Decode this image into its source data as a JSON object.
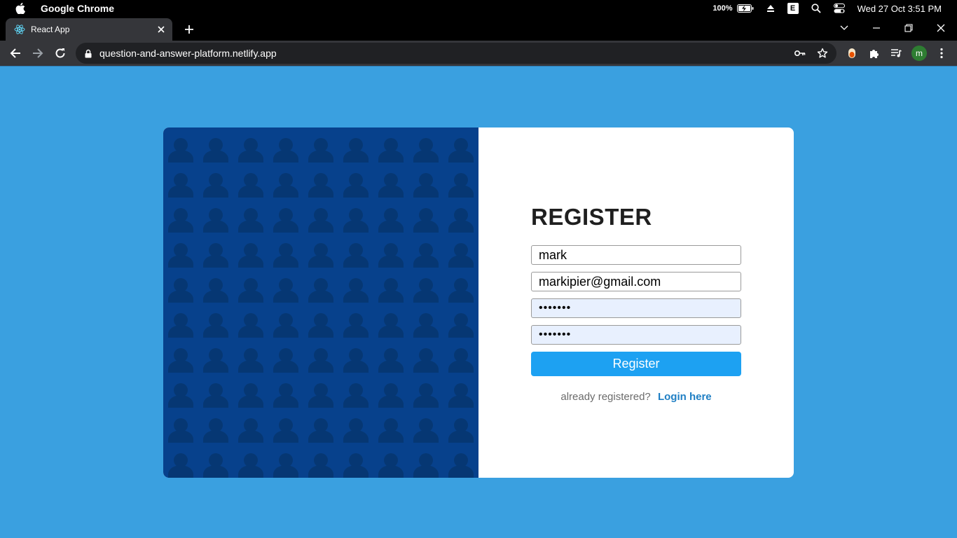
{
  "menubar": {
    "app_name": "Google Chrome",
    "battery_percent": "100%",
    "e_badge": "E",
    "clock": "Wed 27 Oct 3:51 PM",
    "icons": [
      "apple-icon",
      "battery-icon",
      "eject-icon",
      "e-badge-icon",
      "search-icon",
      "control-center-icon"
    ]
  },
  "browser": {
    "tab_title": "React App",
    "url": "question-and-answer-platform.netlify.app",
    "profile_initial": "m"
  },
  "register": {
    "title": "REGISTER",
    "username_value": "mark",
    "email_value": "markipier@gmail.com",
    "password_value": "•••••••",
    "confirm_password_value": "•••••••",
    "button_label": "Register",
    "already_text": "already registered?",
    "login_link": "Login here"
  },
  "colors": {
    "page_background": "#3aa0e0",
    "left_panel": "#07418c",
    "pattern_person": "#063773",
    "button": "#1da1f2",
    "link": "#1f7fc4"
  }
}
